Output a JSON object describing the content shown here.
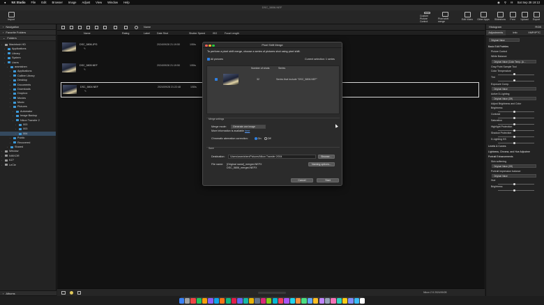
{
  "menubar": {
    "app": "NX Studio",
    "items": [
      "File",
      "Edit",
      "Browser",
      "Image",
      "Adjust",
      "View",
      "Window",
      "Help"
    ],
    "clock": "Sat Sep 28  19:13"
  },
  "window": {
    "title": "DSC_5806.NEF"
  },
  "toolbar": {
    "import": "Import",
    "buttons": [
      "Custom Picture Control",
      "Pixel shift merge",
      "Edit Video",
      "Other Apps",
      "Slideshow",
      "Print",
      "Upload",
      "Export"
    ]
  },
  "sidebar": {
    "browser_label": "Navigation",
    "favorites_label": "Favorite Folders",
    "folders_label": "Folders",
    "tree": [
      {
        "label": "Macintosh HD",
        "level": 0,
        "type": "disk"
      },
      {
        "label": "Applications",
        "level": 1,
        "type": "folder"
      },
      {
        "label": "Library",
        "level": 1,
        "type": "folder"
      },
      {
        "label": "System",
        "level": 1,
        "type": "folder"
      },
      {
        "label": "Users",
        "level": 1,
        "type": "folder"
      },
      {
        "label": "aramishen",
        "level": 2,
        "type": "folder"
      },
      {
        "label": "Applications",
        "level": 3,
        "type": "folder"
      },
      {
        "label": "Calibre Library",
        "level": 3,
        "type": "folder"
      },
      {
        "label": "Desktop",
        "level": 3,
        "type": "folder"
      },
      {
        "label": "Documents",
        "level": 3,
        "type": "folder"
      },
      {
        "label": "Downloads",
        "level": 3,
        "type": "folder"
      },
      {
        "label": "Dropbox",
        "level": 3,
        "type": "folder"
      },
      {
        "label": "Movies",
        "level": 3,
        "type": "folder"
      },
      {
        "label": "Music",
        "level": 3,
        "type": "folder"
      },
      {
        "label": "Pictures",
        "level": 3,
        "type": "folder"
      },
      {
        "label": "Automator",
        "level": 4,
        "type": "folder"
      },
      {
        "label": "Image Backup",
        "level": 4,
        "type": "folder"
      },
      {
        "label": "Nikon Transfer 2",
        "level": 4,
        "type": "folder"
      },
      {
        "label": "003",
        "level": 5,
        "type": "folder"
      },
      {
        "label": "003",
        "level": 5,
        "type": "folder"
      },
      {
        "label": "004",
        "level": 5,
        "type": "folder",
        "selected": true
      },
      {
        "label": "Public",
        "level": 3,
        "type": "folder"
      },
      {
        "label": "Recovered",
        "level": 3,
        "type": "folder"
      },
      {
        "label": "Shared",
        "level": 2,
        "type": "folder"
      },
      {
        "label": "Window",
        "level": 0,
        "type": "disk"
      },
      {
        "label": "NIKKOR",
        "level": 0,
        "type": "disk"
      },
      {
        "label": "KZ7",
        "level": 0,
        "type": "disk"
      },
      {
        "label": "LeCie",
        "level": 0,
        "type": "disk"
      }
    ],
    "albums_label": "Albums"
  },
  "viewbar": {
    "sort_label": "Name"
  },
  "columns": [
    "Name",
    "Rating",
    "Label",
    "Date Shot",
    "Shutter Speed",
    "ISO",
    "Focal Length"
  ],
  "rows": [
    {
      "name": "DSC_5806.JPG",
      "date": "2024/09/28 21:19:50",
      "shutter": "1/50s",
      "focal": "24.0mm"
    },
    {
      "name": "DSC_5805.NEF",
      "date": "2024/09/28 21:19:50",
      "shutter": "1/50s",
      "focal": "24.0mm"
    },
    {
      "name": "DSC_5804.NEF",
      "date": "2024/09/28 21:22:48",
      "shutter": "1/50s",
      "focal": "24.0mm",
      "selected": true
    }
  ],
  "bottombar": {
    "status": "Nikon Z 8 2024/09/28"
  },
  "dialog": {
    "title": "Pixel Shift Merge",
    "description": "To perform a pixel shift merge, choose a series of pictures shot using pixel shift.",
    "all_pictures": "All pictures",
    "current_selection": "Current selection: 1 series",
    "col_shots": "Number of shots",
    "col_series": "Series",
    "shots_value": "32",
    "series_value": "Series that include \"DSC_5806.NEF\"",
    "merge_settings": "Merge settings",
    "merge_mode_label": "Merge mode:",
    "merge_mode_value": "Generate one image",
    "more_info": "More information is available",
    "more_info_link": "here",
    "chromatic_label": "Chromatic aberration correction:",
    "on_label": "On",
    "off_label": "Off",
    "save_label": "Save",
    "destination_label": "Destination:",
    "destination_value": "/Users/aramishen/Pictures/Nikon Transfer 2/004",
    "browse_label": "Browse...",
    "filename_label": "File name:",
    "filename_value_1": "[Original name]_merged.NEFX",
    "filename_value_2": "DSC_5806_merged.NEFX",
    "naming_label": "Naming options...",
    "cancel_label": "Cancel",
    "start_label": "Start"
  },
  "rightpanel": {
    "top_label": "Histogram",
    "top_value": "RGB",
    "tabs": [
      "Adjustments",
      "Info",
      "XMP/IPTC"
    ],
    "preset": "Original Value",
    "sections": [
      {
        "t": "Basic Edit Palettes",
        "h": true
      },
      {
        "t": "Picture Control",
        "h": false
      },
      {
        "t": "White Balance",
        "h": false
      },
      {
        "t": "Original Value (Color Temp. (A...",
        "sel": true
      },
      {
        "t": "Gray Point Sample Tool",
        "h": false
      },
      {
        "t": "Color Temperature",
        "slider": true
      },
      {
        "t": "Tint",
        "slider": true
      },
      {
        "t": "Exposure Comp.",
        "h": false
      },
      {
        "t": "Original Value",
        "sel": true
      },
      {
        "t": "Active D-Lighting",
        "h": false
      },
      {
        "t": "Original Value (Off)",
        "sel": true
      },
      {
        "t": "Adjust Brightness and Color",
        "h": false
      },
      {
        "t": "Brightness",
        "slider": true
      },
      {
        "t": "Contrast",
        "slider": true
      },
      {
        "t": "Saturation",
        "slider": true
      },
      {
        "t": "Highlight Protection",
        "slider": true
      },
      {
        "t": "Shadow Protection",
        "slider": true
      },
      {
        "t": "D-Lighting HS",
        "slider": true
      },
      {
        "t": "Levels & Curves",
        "h": true
      },
      {
        "t": "Lightness, Chroma, and Hue Adjustme",
        "h": true
      },
      {
        "t": "Portrait Enhancements",
        "h": true
      },
      {
        "t": "Skin softening",
        "h": false
      },
      {
        "t": "Original Value (Off)",
        "sel": true
      },
      {
        "t": "Portrait impression balance",
        "h": false
      },
      {
        "t": "Original Value",
        "sel": true
      },
      {
        "t": "Hue",
        "slider": true
      },
      {
        "t": "Brightness",
        "slider": true
      }
    ]
  },
  "dock": {
    "colors": [
      "#3b82f6",
      "#a3a3a3",
      "#ef4444",
      "#22c55e",
      "#f59e0b",
      "#8b5cf6",
      "#0ea5e9",
      "#f97316",
      "#10b981",
      "#e11d48",
      "#6366f1",
      "#14b8a6",
      "#eab308",
      "#64748b",
      "#db2777",
      "#84cc16",
      "#06b6d4",
      "#f43f5e",
      "#a855f7",
      "#22d3ee",
      "#fb923c",
      "#4ade80",
      "#60a5fa",
      "#fbbf24",
      "#c084fc",
      "#94a3b8",
      "#f472b6",
      "#2dd4bf",
      "#facc15",
      "#818cf8",
      "#38bdf8",
      "#ffffff"
    ]
  }
}
